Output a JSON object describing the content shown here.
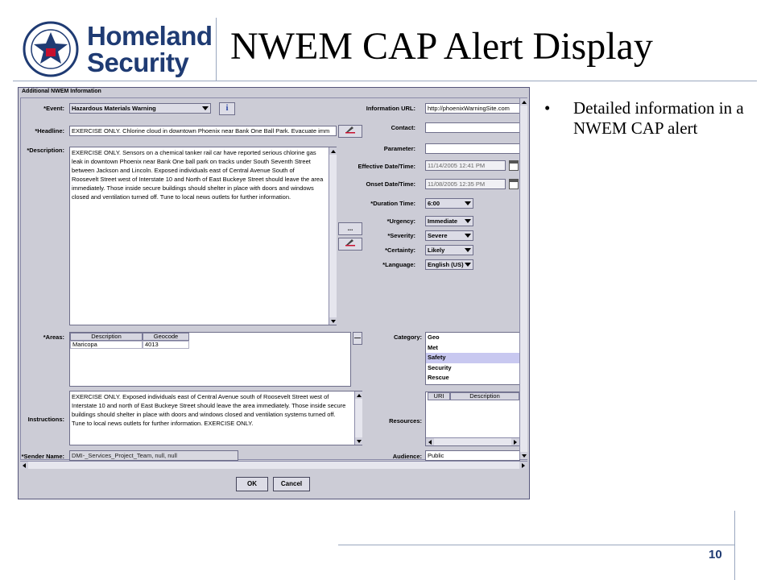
{
  "slide": {
    "title": "NWEM CAP Alert Display",
    "page_number": "10",
    "bullets": [
      {
        "symbol": "•",
        "text": "Detailed information in a NWEM CAP alert"
      }
    ],
    "logo": {
      "line1": "Homeland",
      "line2": "Security"
    }
  },
  "dialog": {
    "title": "Additional NWEM Information",
    "event": {
      "label": "*Event:",
      "value": "Hazardous Materials Warning",
      "info_glyph": "i"
    },
    "headline": {
      "label": "*Headline:",
      "value": "EXERCISE ONLY.  Chlorine cloud in downtown Phoenix near Bank One Ball Park.  Evacuate imm"
    },
    "description": {
      "label": "*Description:",
      "lines": [
        "EXERCISE ONLY.  Sensors on a chemical tanker rail car have reported serious chlorine gas",
        "leak in downtown Phoenix near Bank One ball park on tracks under South Seventh Street",
        "between Jackson and Lincoln.  Exposed individuals east of Central Avenue South of",
        "Roosevelt Street west of Interstate 10 and North of East Buckeye Street should leave the area",
        "immediately.  Those inside secure buildings should shelter in place with doors and windows",
        "closed and ventilation turned off. Tune to local news outlets for further information."
      ]
    },
    "ellipsis_label": "...",
    "information_url": {
      "label": "Information URL:",
      "value": "http://phoenixWarningSite.com"
    },
    "contact": {
      "label": "Contact:",
      "value": ""
    },
    "parameter": {
      "label": "Parameter:",
      "value": ""
    },
    "effective": {
      "label": "Effective Date/Time:",
      "value": "11/14/2005 12:41 PM"
    },
    "onset": {
      "label": "Onset Date/Time:",
      "value": "11/08/2005 12:35 PM"
    },
    "duration": {
      "label": "*Duration Time:",
      "value": "6:00"
    },
    "urgency": {
      "label": "*Urgency:",
      "value": "Immediate"
    },
    "severity": {
      "label": "*Severity:",
      "value": "Severe"
    },
    "certainty": {
      "label": "*Certainty:",
      "value": "Likely"
    },
    "language": {
      "label": "*Language:",
      "value": "English (US)"
    },
    "areas": {
      "label": "*Areas:",
      "columns": [
        "Description",
        "Geocode"
      ],
      "rows": [
        [
          "Maricopa",
          "4013"
        ]
      ],
      "remove_label": "—"
    },
    "category": {
      "label": "Category:",
      "items": [
        "Geo",
        "Met",
        "Safety",
        "Security",
        "Rescue"
      ],
      "selected": "Safety"
    },
    "instructions": {
      "label": "Instructions:",
      "lines": [
        "EXERCISE ONLY.  Exposed individuals east of Central Avenue south of Roosevelt Street west of",
        "Interstate 10 and north of East Buckeye Street should leave the area immediately.  Those inside secure",
        "buildings should shelter in place with doors and windows closed and ventilation systems turned off.",
        "Tune to local news outlets for further information.  EXERCISE ONLY."
      ]
    },
    "resources": {
      "label": "Resources:",
      "columns": [
        "URI",
        "Description"
      ]
    },
    "sender": {
      "label": "*Sender Name:",
      "value": "DMI-_Services_Project_Team, null, null"
    },
    "audience": {
      "label": "Audience:",
      "value": "Public"
    },
    "buttons": {
      "ok": "OK",
      "cancel": "Cancel"
    }
  },
  "colors": {
    "brand_blue": "#1f3b73",
    "dialog_bg": "#ccccd6",
    "selection": "#c8c8f0"
  },
  "icons": [
    "dhs-seal-icon",
    "info-icon",
    "edit-pencil-icon",
    "calendar-icon",
    "dropdown-arrow-icon",
    "scroll-arrow-icon"
  ]
}
